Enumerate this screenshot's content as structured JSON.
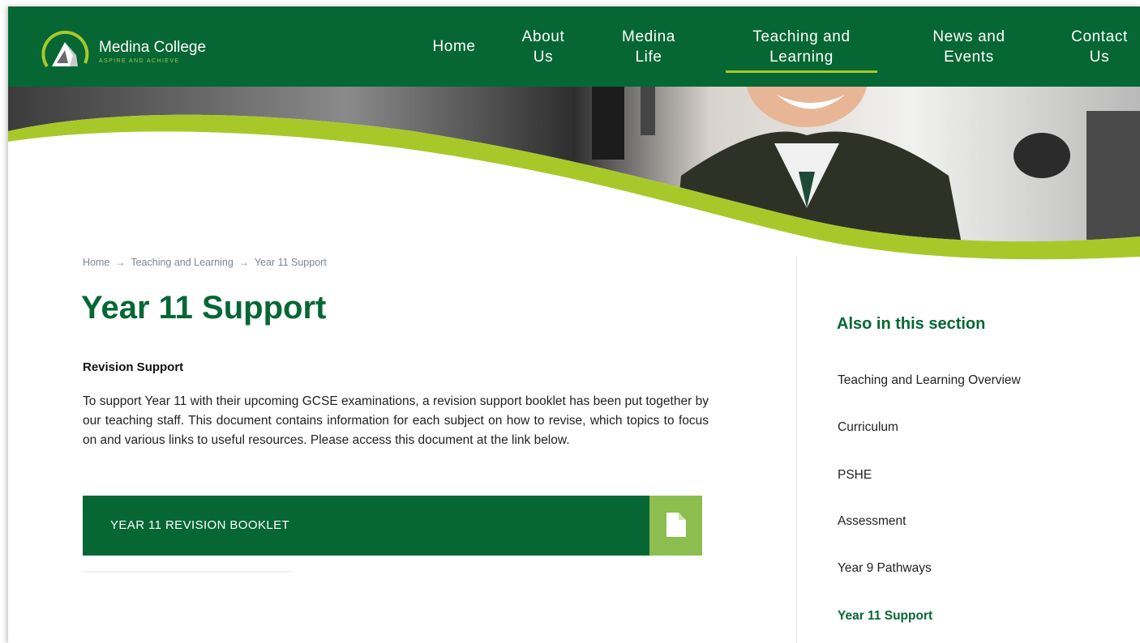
{
  "site": {
    "name": "Medina College",
    "tagline": "ASPIRE AND ACHIEVE"
  },
  "nav": {
    "items": [
      {
        "line1": "Home",
        "line2": ""
      },
      {
        "line1": "About",
        "line2": "Us"
      },
      {
        "line1": "Medina",
        "line2": "Life"
      },
      {
        "line1": "Teaching and",
        "line2": "Learning"
      },
      {
        "line1": "News and",
        "line2": "Events"
      },
      {
        "line1": "Contact",
        "line2": "Us"
      }
    ],
    "active_index": 3
  },
  "breadcrumb": {
    "items": [
      "Home",
      "Teaching and Learning",
      "Year 11 Support"
    ],
    "separator": "→"
  },
  "page": {
    "title": "Year 11 Support",
    "subheading": "Revision Support",
    "body": "To support Year 11 with their upcoming GCSE examinations, a revision support booklet has been put together by our teaching staff. This document contains information for each subject on how to revise, which topics to focus on and various links to useful resources. Please access this document at the link below.",
    "document_link": "YEAR 11 REVISION BOOKLET",
    "document_icon": "document-icon"
  },
  "sidebar": {
    "title": "Also in this section",
    "items": [
      "Teaching and Learning Overview",
      "Curriculum",
      "PSHE",
      "Assessment",
      "Year 9 Pathways",
      "Year 11 Support"
    ],
    "active_index": 5
  },
  "colors": {
    "brand_green": "#066734",
    "accent_lime": "#a8c82a",
    "icon_green": "#8cbd4f"
  }
}
